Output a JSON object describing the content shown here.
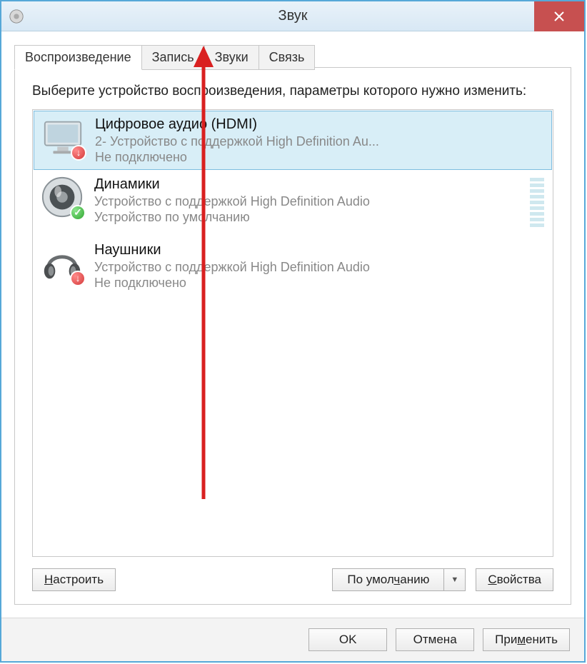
{
  "window": {
    "title": "Звук"
  },
  "tabs": [
    {
      "label": "Воспроизведение",
      "active": true
    },
    {
      "label": "Запись",
      "active": false
    },
    {
      "label": "Звуки",
      "active": false
    },
    {
      "label": "Связь",
      "active": false
    }
  ],
  "instruction": "Выберите устройство воспроизведения, параметры которого нужно изменить:",
  "devices": [
    {
      "name": "Цифровое аудио (HDMI)",
      "desc": "2- Устройство с поддержкой High Definition Au...",
      "status": "Не подключено",
      "icon": "monitor",
      "badge": "down",
      "selected": true,
      "meter": false
    },
    {
      "name": "Динамики",
      "desc": "Устройство с поддержкой High Definition Audio",
      "status": "Устройство по умолчанию",
      "icon": "speaker",
      "badge": "ok",
      "selected": false,
      "meter": true
    },
    {
      "name": "Наушники",
      "desc": "Устройство с поддержкой High Definition Audio",
      "status": "Не подключено",
      "icon": "headphones",
      "badge": "down",
      "selected": false,
      "meter": false
    }
  ],
  "buttons": {
    "configure": "Настроить",
    "default": "По умолчанию",
    "properties": "Свойства",
    "ok": "OK",
    "cancel": "Отмена",
    "apply": "Применить"
  }
}
